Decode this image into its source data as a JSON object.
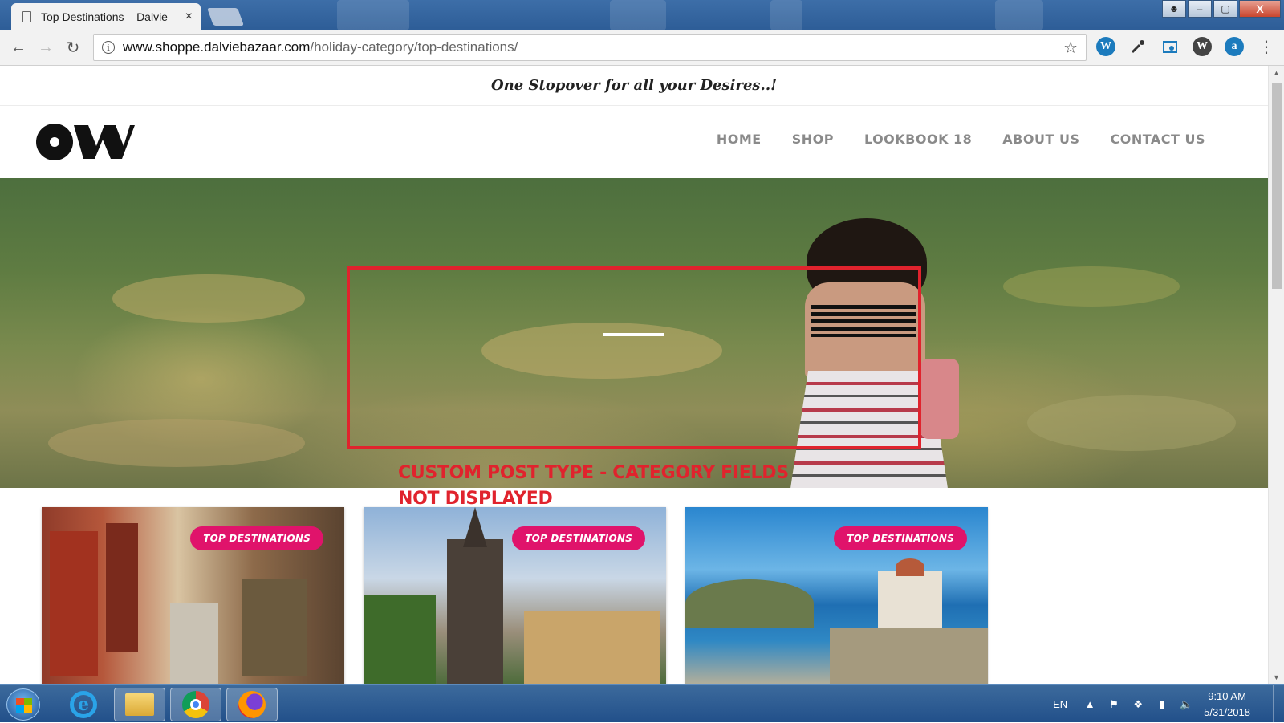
{
  "browser": {
    "tab_title": "Top Destinations – Dalvie",
    "tab_close": "×",
    "url_host": "www.shoppe.dalviebazaar.com",
    "url_path": "/holiday-category/top-destinations/",
    "back": "←",
    "forward": "→",
    "reload": "↻",
    "star": "☆",
    "menu": "⋮",
    "window_buttons": {
      "minimize": "–",
      "maximize": "▢",
      "close": "X"
    },
    "extensions": [
      "W",
      "a"
    ]
  },
  "site": {
    "tagline": "One Stopover for all your Desires..!",
    "nav": [
      "HOME",
      "SHOP",
      "LOOKBOOK 18",
      "ABOUT US",
      "CONTACT US"
    ],
    "annotation": "CUSTOM POST TYPE - CATEGORY FIELDS NOT DISPLAYED",
    "cards": [
      {
        "badge": "TOP DESTINATIONS"
      },
      {
        "badge": "TOP DESTINATIONS"
      },
      {
        "badge": "TOP DESTINATIONS"
      }
    ]
  },
  "taskbar": {
    "language": "EN",
    "time": "9:10 AM",
    "date": "5/31/2018",
    "apps": [
      "internet-explorer",
      "file-explorer",
      "chrome",
      "firefox"
    ]
  },
  "colors": {
    "accent_pink": "#e0136b",
    "annotation_red": "#e0232d",
    "nav_gray": "#8a8a8a"
  }
}
